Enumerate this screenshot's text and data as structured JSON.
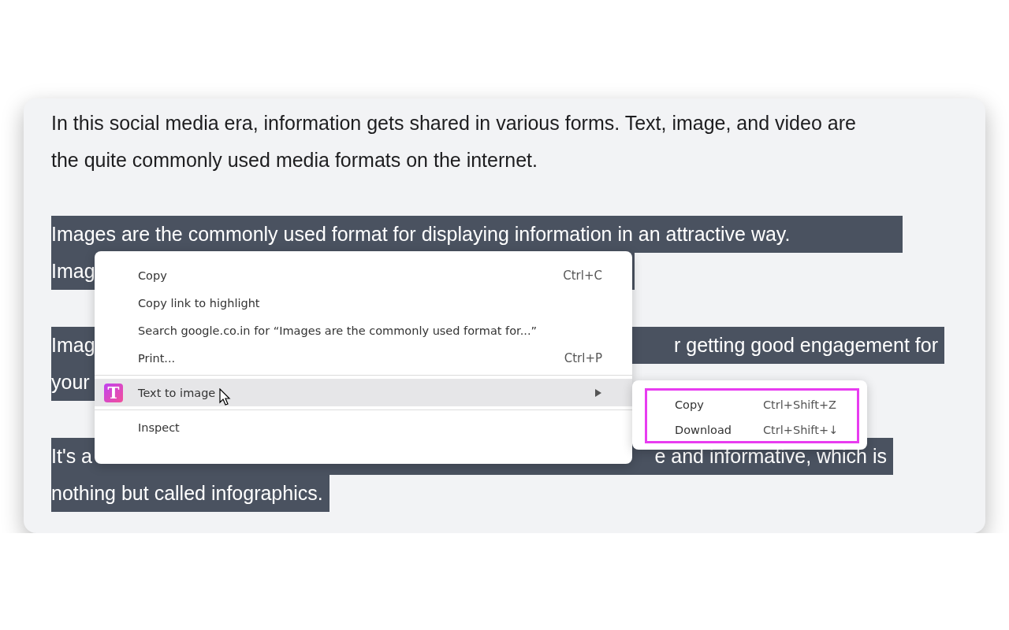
{
  "article": {
    "paragraphs": [
      {
        "selected": false,
        "lines": [
          [
            "In this social media era, information gets shared in various forms. Text, image, and video are"
          ],
          [
            "the quite commonly used media formats on the internet."
          ]
        ]
      },
      {
        "selected": true,
        "lines": [
          [
            "Images are the commonly used format for displaying information in an attractive way."
          ],
          [
            "Imag"
          ]
        ]
      },
      {
        "selected": true,
        "lines": [
          [
            "Imag",
            "r getting good engagement for"
          ],
          [
            "your"
          ]
        ]
      },
      {
        "selected": true,
        "lines": [
          [
            "It's a",
            "e and informative, which is"
          ],
          [
            "nothing but called infographics."
          ]
        ]
      }
    ]
  },
  "context_menu": {
    "items": [
      {
        "kind": "item",
        "label": "Copy",
        "shortcut": "Ctrl+C"
      },
      {
        "kind": "item",
        "label": "Copy link to highlight"
      },
      {
        "kind": "item",
        "label": "Search google.co.in for “Images are the commonly used format for...”"
      },
      {
        "kind": "item",
        "label": "Print...",
        "shortcut": "Ctrl+P"
      },
      {
        "kind": "separator"
      },
      {
        "kind": "submenu",
        "label": "Text to image",
        "icon_letter": "T",
        "highlighted": true
      },
      {
        "kind": "separator"
      },
      {
        "kind": "item",
        "label": "Inspect"
      }
    ]
  },
  "submenu": {
    "outlined": true,
    "items": [
      {
        "label": "Copy",
        "shortcut": "Ctrl+Shift+Z"
      },
      {
        "label": "Download",
        "shortcut": "Ctrl+Shift+↓"
      }
    ]
  }
}
